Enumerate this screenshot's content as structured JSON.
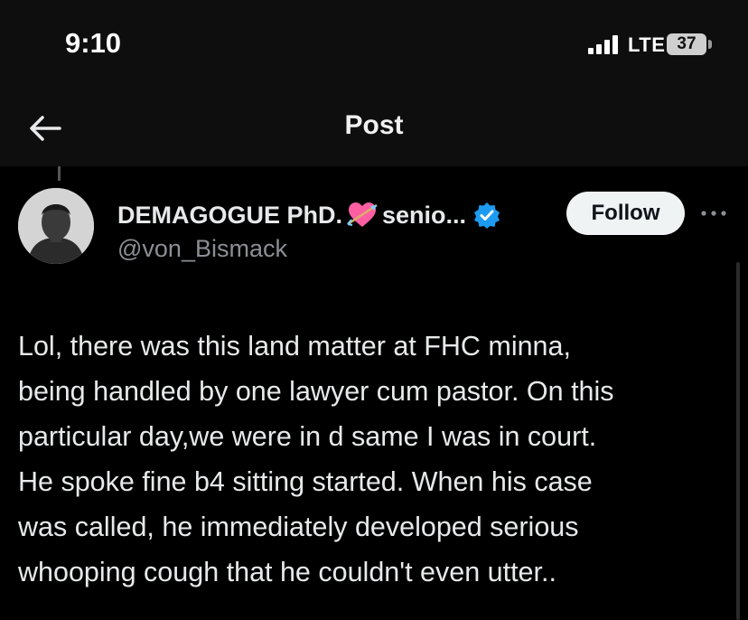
{
  "status_bar": {
    "time": "9:10",
    "network": "LTE",
    "battery": "37"
  },
  "nav": {
    "title": "Post",
    "back_icon": "arrow-left-icon"
  },
  "author": {
    "display_name": "DEMAGOGUE PhD.",
    "emoji": "heart-with-arrow",
    "name_suffix": "senio...",
    "verified_color": "#1d9bf0",
    "handle": "@von_Bismack"
  },
  "actions": {
    "follow_label": "Follow",
    "more_icon": "more-horizontal-icon"
  },
  "tweet": {
    "lines": [
      "Lol, there was this land matter at FHC minna,",
      "being handled by one lawyer cum pastor. On this",
      "particular day,we were in d same I was in court.",
      "He spoke fine b4 sitting started. When his case",
      "was called, he immediately developed serious",
      "whooping cough that he couldn't even utter.."
    ]
  }
}
